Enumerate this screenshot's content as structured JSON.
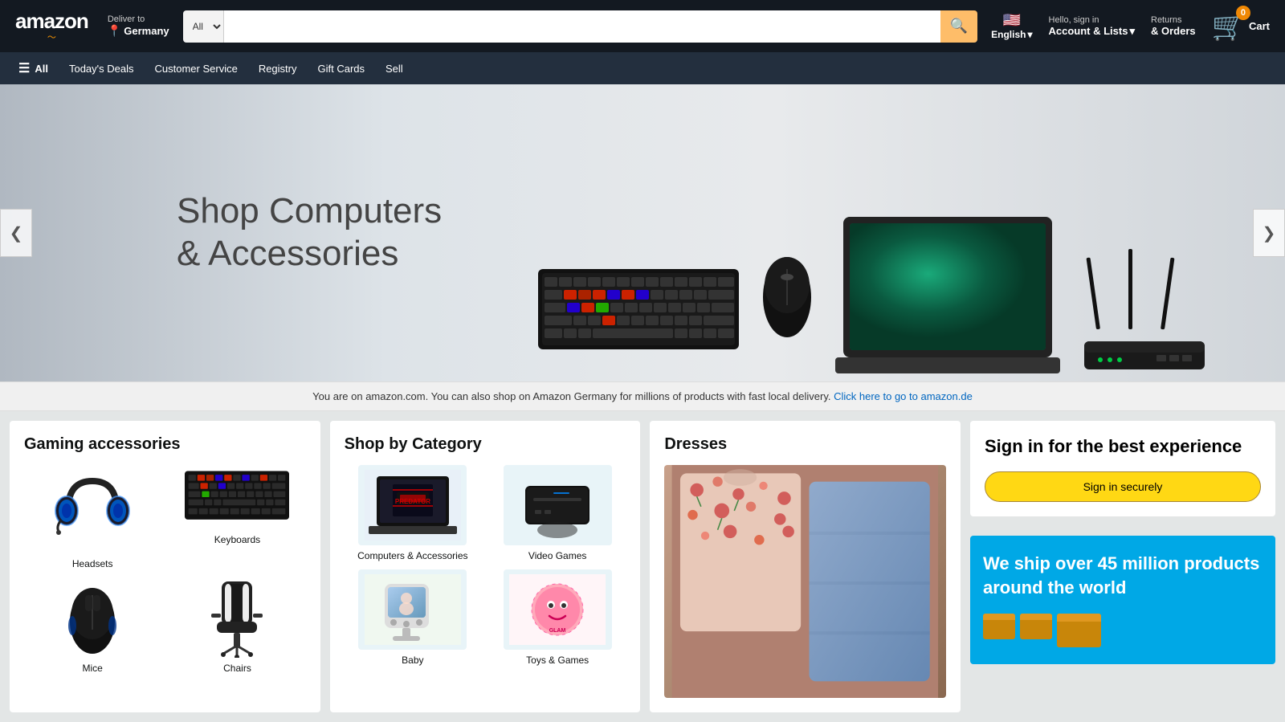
{
  "header": {
    "logo": "amazon",
    "logo_smile": "~",
    "deliver_label": "Deliver to",
    "deliver_location": "Germany",
    "search_placeholder": "",
    "search_category": "All",
    "lang_label": "English",
    "account_top": "Hello, sign in",
    "account_bottom": "Account & Lists",
    "account_dropdown": "▾",
    "returns_top": "Returns",
    "returns_bottom": "& Orders",
    "cart_count": "0",
    "cart_label": "Cart"
  },
  "navbar": {
    "all_label": "All",
    "items": [
      {
        "label": "Today's Deals"
      },
      {
        "label": "Customer Service"
      },
      {
        "label": "Registry"
      },
      {
        "label": "Gift Cards"
      },
      {
        "label": "Sell"
      }
    ]
  },
  "hero": {
    "title_line1": "Shop Computers",
    "title_line2": "& Accessories",
    "arrow_left": "❮",
    "arrow_right": "❯"
  },
  "notification": {
    "text": "You are on amazon.com. You can also shop on Amazon Germany for millions of products with fast local delivery.",
    "link_text": "Click here to go to amazon.de"
  },
  "cards": {
    "gaming": {
      "title": "Gaming accessories",
      "items": [
        {
          "label": "Headsets"
        },
        {
          "label": "Keyboards"
        },
        {
          "label": "Mice"
        },
        {
          "label": "Chairs"
        }
      ]
    },
    "category": {
      "title": "Shop by Category",
      "items": [
        {
          "label": "Computers & Accessories"
        },
        {
          "label": "Video Games"
        },
        {
          "label": "Baby"
        },
        {
          "label": "Toys & Games"
        }
      ]
    },
    "dresses": {
      "title": "Dresses"
    },
    "signin": {
      "title": "Sign in for the best experience",
      "button_label": "Sign in securely"
    },
    "ship": {
      "text": "We ship over 45 million products around the world"
    }
  },
  "icons": {
    "search": "🔍",
    "location_pin": "📍",
    "hamburger": "☰",
    "arrow_left": "❮",
    "arrow_right": "❯"
  }
}
